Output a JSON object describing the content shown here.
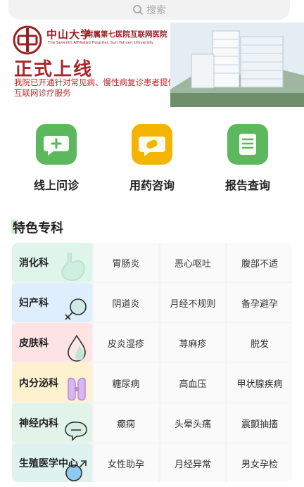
{
  "search": {
    "placeholder": "搜索"
  },
  "banner": {
    "university": "中山大学",
    "hospital": "附属第七医院互联网医院",
    "english": "The Seventh Affiliated Hospital, Sun Yat-sen University",
    "headline": "正式上线",
    "description": "我院已开通针对常见病、慢性病复诊患者提供互联网诊疗服务"
  },
  "services": [
    {
      "label": "线上问诊",
      "icon": "chat-plus-icon",
      "color": "#5cb85c"
    },
    {
      "label": "用药咨询",
      "icon": "pill-chat-icon",
      "color": "#f5b400"
    },
    {
      "label": "报告查询",
      "icon": "document-icon",
      "color": "#5cb85c"
    }
  ],
  "section": {
    "title": "特色专科"
  },
  "departments": [
    {
      "name": "消化科",
      "color": "#dff5ec",
      "icon": "stomach-icon",
      "items": [
        "胃肠炎",
        "恶心呕吐",
        "腹部不适"
      ]
    },
    {
      "name": "妇产科",
      "color": "#dfeefc",
      "icon": "female-symbol-icon",
      "items": [
        "阴道炎",
        "月经不规则",
        "备孕避孕"
      ]
    },
    {
      "name": "皮肤科",
      "color": "#fde3e3",
      "icon": "droplet-icon",
      "items": [
        "皮炎湿疹",
        "荨麻疹",
        "脱发"
      ]
    },
    {
      "name": "内分泌科",
      "color": "#fdf1cf",
      "icon": "thyroid-icon",
      "items": [
        "糖尿病",
        "高血压",
        "甲状腺疾病"
      ]
    },
    {
      "name": "神经内科",
      "color": "#e2f4ea",
      "icon": "brain-icon",
      "items": [
        "癫痫",
        "头晕头痛",
        "震颤抽搐"
      ]
    },
    {
      "name": "生殖医学中心",
      "color": "#dff3ee",
      "icon": "male-symbol-icon",
      "items": [
        "女性助孕",
        "月经异常",
        "男女孕检"
      ]
    }
  ]
}
